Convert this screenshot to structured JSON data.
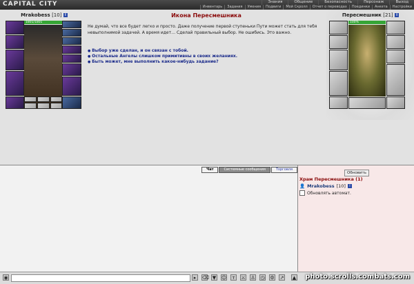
{
  "header": {
    "logo": "CAPITAL CITY",
    "top_menu": [
      "Знания",
      "Общение",
      "Безопасность",
      "Персонаж",
      "Выход"
    ],
    "sub_menu": [
      "Инвентарь",
      "Задания",
      "Умения",
      "Подвиги",
      "Мой Скролл",
      "Отчет о переводах",
      "Поединки",
      "Анкета",
      "Настройки"
    ]
  },
  "player": {
    "name": "Mrakobess",
    "level": "[10]",
    "hp": "1801/1801"
  },
  "npc": {
    "name": "Пересмешник",
    "level": "[21]",
    "hp": "100%"
  },
  "quest": {
    "title": "Икона Пересмешника",
    "text": "Не думай, что все будет легко и просто. Даже получение первой ступеньки Пути может стать для тебя невыполнимой задачей. А время идет… Сделай правильный выбор. Не ошибись. Это важно.",
    "options": [
      "Выбор уже сделан, и он связан с тобой.",
      "Остальные Ангелы слишком примитивны в своих желаниях.",
      "Быть может, мне выполнить какое-нибудь задание?"
    ]
  },
  "chat_tabs": {
    "chat": "Чат",
    "system": "Системные сообщения",
    "trade": "Торговля"
  },
  "sidebar": {
    "refresh": "Обновить",
    "location": "Храм Пересмешника (1)",
    "user": "Mrakobess",
    "user_level": "[10]",
    "auto_refresh": "Обновлять автомат."
  },
  "watermark": "photo.scrolls.combats.com"
}
